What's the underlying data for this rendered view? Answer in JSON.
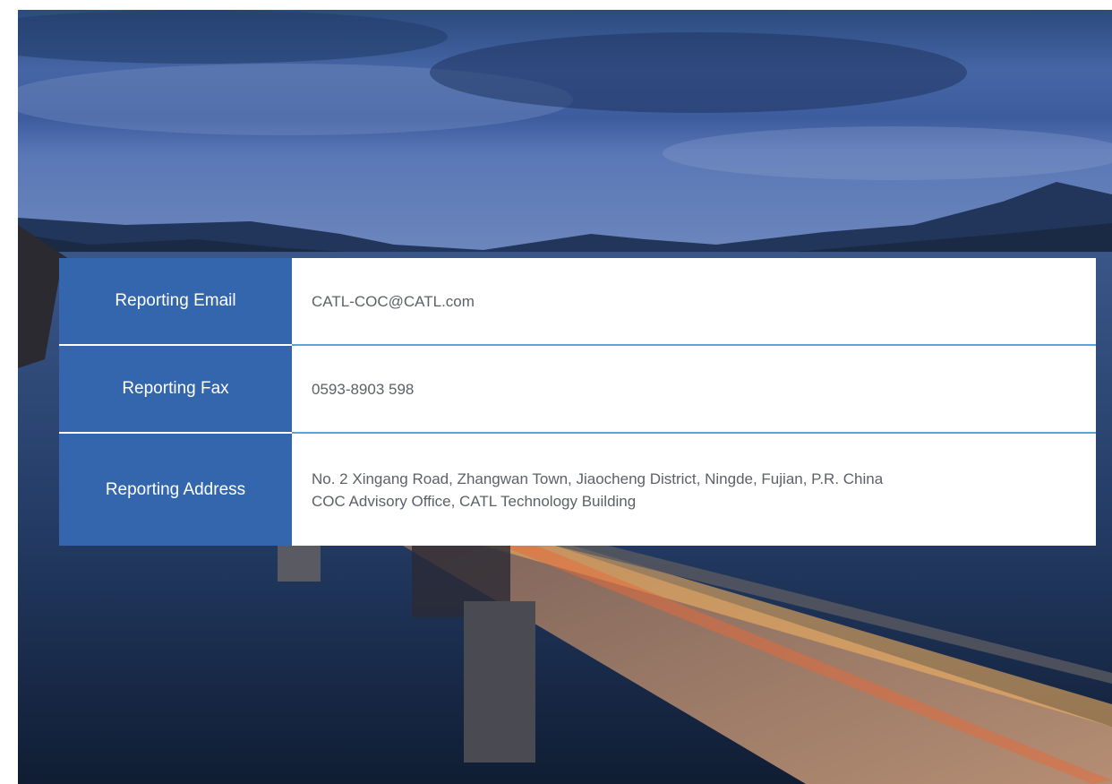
{
  "contact_table": {
    "rows": [
      {
        "label": "Reporting Email",
        "value_lines": [
          "CATL-COC@CATL.com"
        ]
      },
      {
        "label": "Reporting Fax",
        "value_lines": [
          "0593-8903 598"
        ]
      },
      {
        "label": "Reporting Address",
        "value_lines": [
          "No. 2 Xingang Road, Zhangwan Town, Jiaocheng District, Ningde, Fujian, P.R. China",
          "COC Advisory Office, CATL Technology Building"
        ]
      }
    ]
  },
  "colors": {
    "label_background": "#3466ad",
    "divider": "#5ba3d8",
    "value_text": "#5d6167"
  }
}
